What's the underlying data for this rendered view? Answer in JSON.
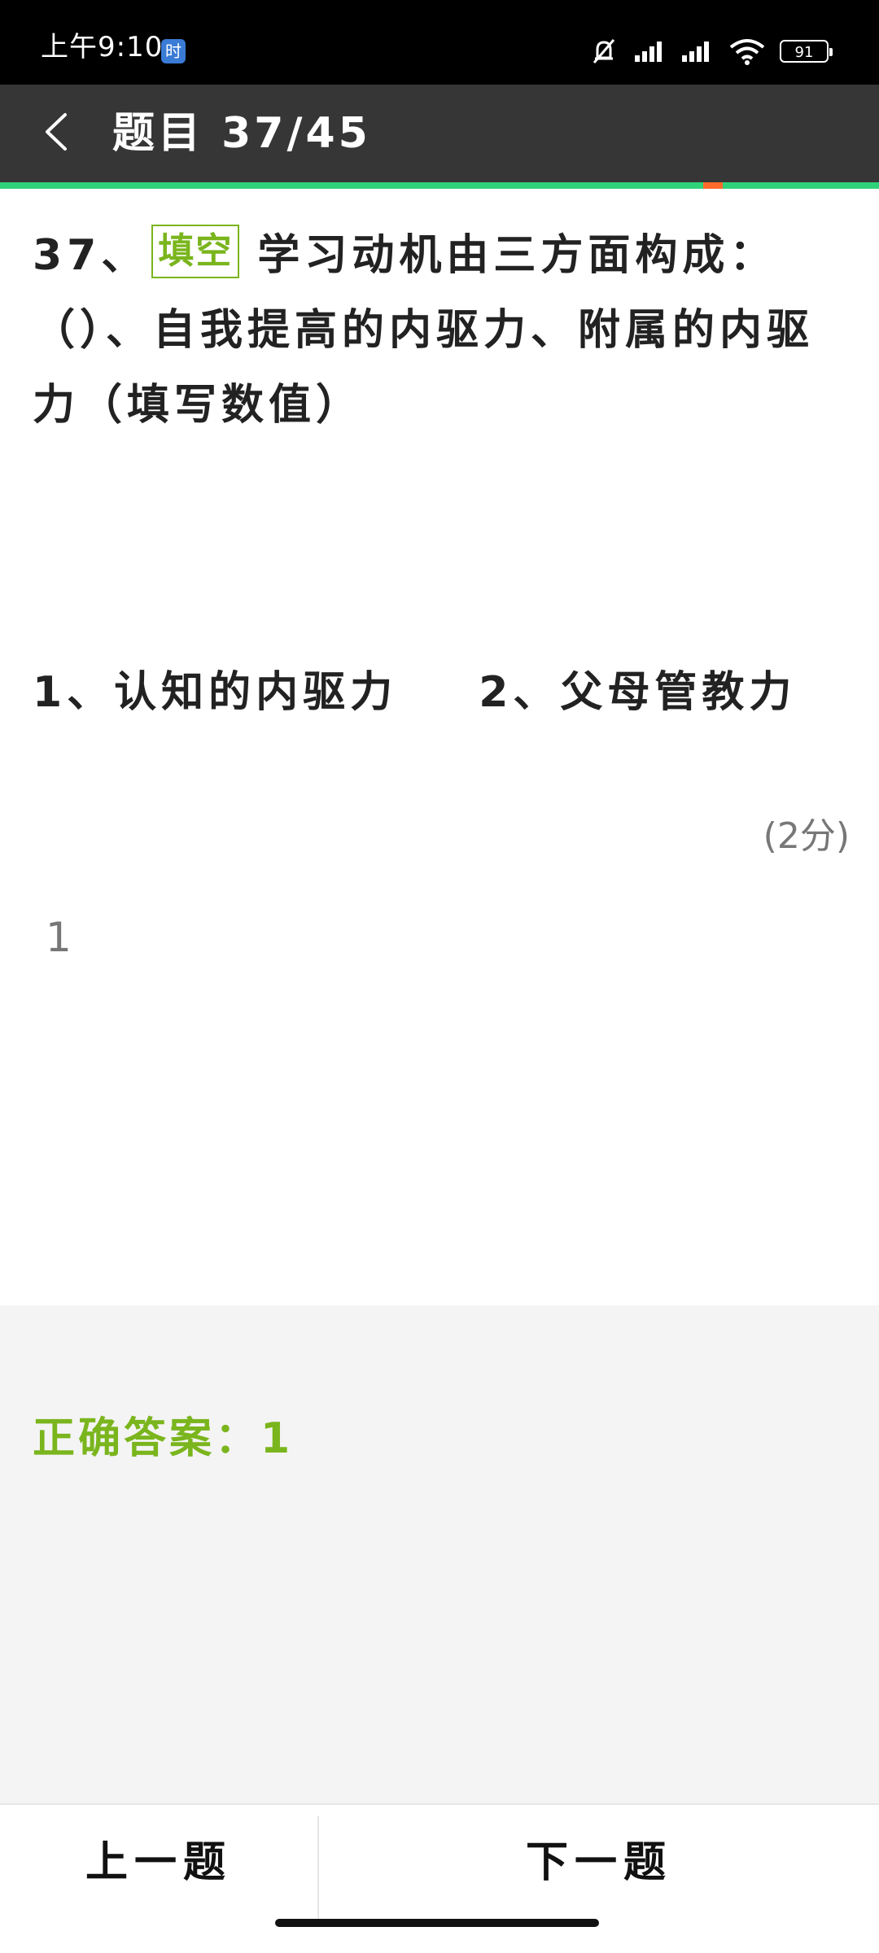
{
  "status_bar": {
    "time": "上午9:10",
    "app_badge": "时",
    "battery": "91",
    "icons": [
      "mute-bell-icon",
      "signal-1-icon",
      "signal-2-icon",
      "wifi-icon",
      "battery-icon"
    ]
  },
  "header": {
    "title": "题目 37/45",
    "back_icon": "chevron-left-icon",
    "progress": {
      "current": 37,
      "total": 45
    },
    "colors": {
      "background": "#363636",
      "progress_track": "#2fd27a",
      "progress_marker": "#ff6a2a"
    }
  },
  "question": {
    "number": "37、",
    "type_tag": "填空",
    "text": "学习动机由三方面构成：（）、自我提高的内驱力、附属的内驱力（填写数值）",
    "options": [
      {
        "label": "1、认知的内驱力"
      },
      {
        "label": "2、父母管教力"
      }
    ],
    "score": "(2分)",
    "answer_value": "1"
  },
  "answer_panel": {
    "correct_answer": "正确答案：1",
    "accent_color": "#7ab51d"
  },
  "bottom_nav": {
    "prev_label": "上一题",
    "next_label": "下一题"
  }
}
